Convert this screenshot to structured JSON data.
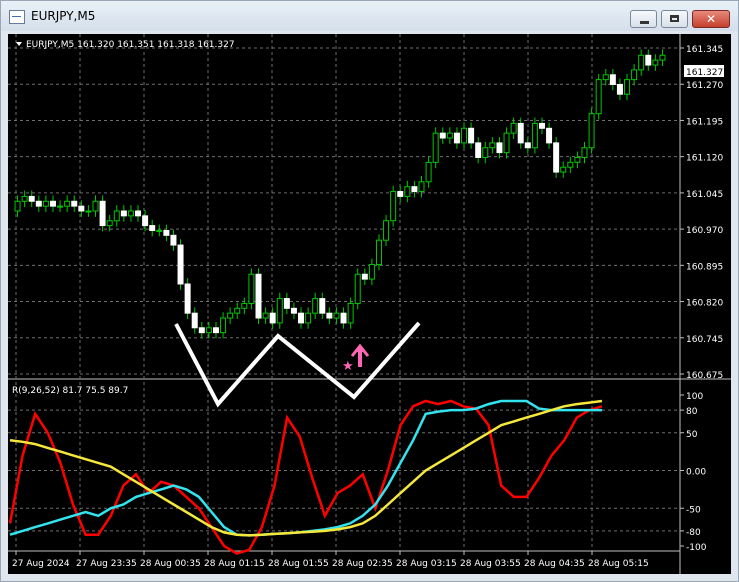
{
  "window": {
    "title": "EURJPY,M5"
  },
  "chart": {
    "header": "EURJPY,M5  161.320 161.351 161.318 161.327",
    "current_price_label": "161.327",
    "colors": {
      "up": "#00c800",
      "background": "#000000",
      "grid": "#7a7a7a",
      "text": "#ffffff"
    }
  },
  "indicator": {
    "label": "R(9,26,52) 81.7 75.5 89.7",
    "lines": [
      {
        "color": "#ff0000"
      },
      {
        "color": "#33e3ef"
      },
      {
        "color": "#f5e83a"
      }
    ]
  },
  "price_axis": [
    "161.345",
    "161.270",
    "161.195",
    "161.120",
    "161.045",
    "160.970",
    "160.895",
    "160.820",
    "160.745",
    "160.675"
  ],
  "indicator_axis": [
    "100",
    "80",
    "50",
    "0.00",
    "-50",
    "-80",
    "-100"
  ],
  "time_axis": [
    "27 Aug 2024",
    "27 Aug 23:35",
    "28 Aug 00:35",
    "28 Aug 01:15",
    "28 Aug 01:55",
    "28 Aug 02:35",
    "28 Aug 03:15",
    "28 Aug 03:55",
    "28 Aug 04:35",
    "28 Aug 05:15"
  ],
  "icons": [
    "application-icon",
    "minimize-icon",
    "maximize-icon",
    "close-icon",
    "dropdown-triangle-icon",
    "buy-arrow-icon",
    "star-icon"
  ],
  "chart_data": {
    "type": "candlestick",
    "price_open_close": [
      [
        161.01,
        161.03
      ],
      [
        161.03,
        161.04
      ],
      [
        161.04,
        161.03
      ],
      [
        161.03,
        161.02
      ],
      [
        161.02,
        161.03
      ],
      [
        161.03,
        161.02
      ],
      [
        161.02,
        161.02
      ],
      [
        161.02,
        161.03
      ],
      [
        161.03,
        161.02
      ],
      [
        161.02,
        161.01
      ],
      [
        161.01,
        161.01
      ],
      [
        161.01,
        161.03
      ],
      [
        161.03,
        160.98
      ],
      [
        160.98,
        160.99
      ],
      [
        160.99,
        161.01
      ],
      [
        161.01,
        161.0
      ],
      [
        161.0,
        161.01
      ],
      [
        161.01,
        161.0
      ],
      [
        161.0,
        160.98
      ],
      [
        160.98,
        160.97
      ],
      [
        160.97,
        160.97
      ],
      [
        160.97,
        160.96
      ],
      [
        160.96,
        160.94
      ],
      [
        160.94,
        160.86
      ],
      [
        160.86,
        160.8
      ],
      [
        160.8,
        160.77
      ],
      [
        160.77,
        160.76
      ],
      [
        160.76,
        160.77
      ],
      [
        160.77,
        160.76
      ],
      [
        160.76,
        160.79
      ],
      [
        160.79,
        160.8
      ],
      [
        160.8,
        160.81
      ],
      [
        160.81,
        160.82
      ],
      [
        160.82,
        160.88
      ],
      [
        160.88,
        160.79
      ],
      [
        160.79,
        160.8
      ],
      [
        160.8,
        160.78
      ],
      [
        160.78,
        160.83
      ],
      [
        160.83,
        160.81
      ],
      [
        160.81,
        160.8
      ],
      [
        160.8,
        160.78
      ],
      [
        160.78,
        160.8
      ],
      [
        160.8,
        160.83
      ],
      [
        160.83,
        160.8
      ],
      [
        160.8,
        160.79
      ],
      [
        160.79,
        160.8
      ],
      [
        160.8,
        160.78
      ],
      [
        160.78,
        160.82
      ],
      [
        160.82,
        160.88
      ],
      [
        160.88,
        160.87
      ],
      [
        160.87,
        160.9
      ],
      [
        160.9,
        160.95
      ],
      [
        160.95,
        160.99
      ],
      [
        160.99,
        161.05
      ],
      [
        161.05,
        161.04
      ],
      [
        161.04,
        161.06
      ],
      [
        161.06,
        161.05
      ],
      [
        161.05,
        161.07
      ],
      [
        161.07,
        161.11
      ],
      [
        161.11,
        161.17
      ],
      [
        161.17,
        161.16
      ],
      [
        161.16,
        161.17
      ],
      [
        161.17,
        161.15
      ],
      [
        161.15,
        161.18
      ],
      [
        161.18,
        161.15
      ],
      [
        161.15,
        161.12
      ],
      [
        161.12,
        161.14
      ],
      [
        161.14,
        161.15
      ],
      [
        161.15,
        161.13
      ],
      [
        161.13,
        161.17
      ],
      [
        161.17,
        161.19
      ],
      [
        161.19,
        161.15
      ],
      [
        161.15,
        161.14
      ],
      [
        161.14,
        161.19
      ],
      [
        161.19,
        161.18
      ],
      [
        161.18,
        161.15
      ],
      [
        161.15,
        161.09
      ],
      [
        161.09,
        161.1
      ],
      [
        161.1,
        161.11
      ],
      [
        161.11,
        161.12
      ],
      [
        161.12,
        161.14
      ],
      [
        161.14,
        161.21
      ],
      [
        161.21,
        161.28
      ],
      [
        161.28,
        161.29
      ],
      [
        161.29,
        161.27
      ],
      [
        161.27,
        161.25
      ],
      [
        161.25,
        161.28
      ],
      [
        161.28,
        161.3
      ],
      [
        161.3,
        161.33
      ],
      [
        161.33,
        161.31
      ],
      [
        161.31,
        161.32
      ],
      [
        161.32,
        161.33
      ]
    ],
    "indicator": {
      "red": [
        -70,
        20,
        75,
        50,
        10,
        -45,
        -85,
        -85,
        -60,
        -20,
        -5,
        -30,
        -15,
        -20,
        -35,
        -50,
        -75,
        -100,
        -110,
        -105,
        -75,
        -20,
        70,
        45,
        -10,
        -60,
        -30,
        -20,
        -5,
        -50,
        0,
        60,
        85,
        92,
        88,
        92,
        85,
        82,
        60,
        -20,
        -35,
        -35,
        -10,
        20,
        40,
        70,
        80,
        85
      ],
      "cyan": [
        -85,
        -80,
        -75,
        -70,
        -65,
        -60,
        -55,
        -60,
        -50,
        -45,
        -35,
        -30,
        -25,
        -20,
        -25,
        -35,
        -55,
        -75,
        -85,
        -86,
        -85,
        -84,
        -83,
        -82,
        -80,
        -78,
        -75,
        -70,
        -60,
        -45,
        -20,
        10,
        40,
        75,
        78,
        80,
        80,
        82,
        88,
        92,
        92,
        92,
        82,
        80,
        80,
        80,
        80,
        80
      ],
      "yellow": [
        40,
        38,
        35,
        30,
        25,
        20,
        15,
        10,
        5,
        -5,
        -15,
        -25,
        -35,
        -45,
        -55,
        -65,
        -75,
        -82,
        -85,
        -86,
        -85,
        -84,
        -83,
        -82,
        -81,
        -80,
        -78,
        -75,
        -70,
        -60,
        -45,
        -30,
        -15,
        0,
        10,
        20,
        30,
        40,
        50,
        60,
        65,
        70,
        75,
        80,
        85,
        88,
        90,
        92
      ]
    },
    "ylim_price": [
      160.675,
      161.345
    ],
    "ylim_indicator": [
      -100,
      100
    ]
  }
}
